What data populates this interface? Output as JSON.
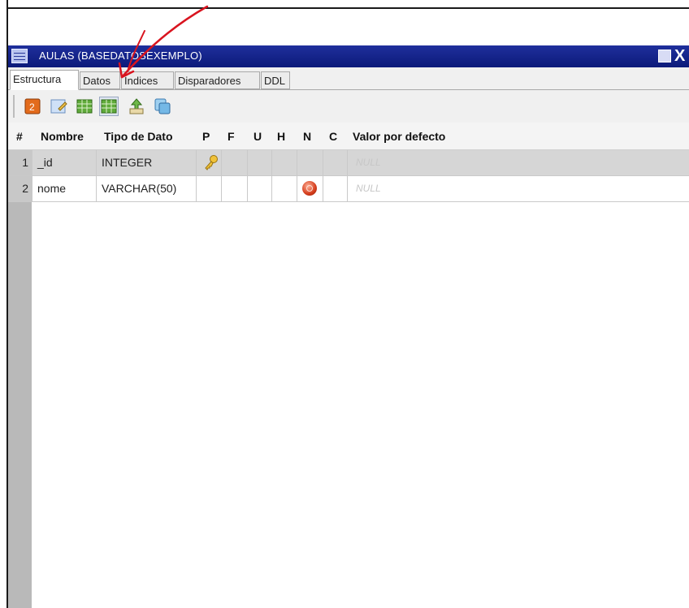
{
  "window": {
    "title": "AULAS (BASEDATOSEXEMPLO)",
    "controls": {
      "close_glyph": "X"
    }
  },
  "tabs": [
    {
      "label": "Estructura",
      "active": true
    },
    {
      "label": "Datos",
      "active": false
    },
    {
      "label": "Índices",
      "active": false
    },
    {
      "label": "Disparadores",
      "active": false
    },
    {
      "label": "DDL",
      "active": false
    }
  ],
  "toolbar": {
    "buttons": [
      {
        "name": "add-field-icon"
      },
      {
        "name": "edit-field-icon"
      },
      {
        "name": "grid-add-icon"
      },
      {
        "name": "grid-edit-icon"
      },
      {
        "name": "move-field-icon"
      },
      {
        "name": "copy-icon"
      }
    ]
  },
  "table": {
    "columns": [
      "#",
      "Nombre",
      "Tipo de Dato",
      "P",
      "F",
      "U",
      "H",
      "N",
      "C",
      "Valor por defecto"
    ],
    "rows": [
      {
        "num": "1",
        "name": "_id",
        "type": "INTEGER",
        "primary_key": true,
        "not_null": false,
        "default": "NULL"
      },
      {
        "num": "2",
        "name": "nome",
        "type": "VARCHAR(50)",
        "primary_key": false,
        "not_null": true,
        "default": "NULL"
      }
    ]
  },
  "colors": {
    "titlebar": "#0c1a7a",
    "annotation_arrow": "#d9141f"
  }
}
